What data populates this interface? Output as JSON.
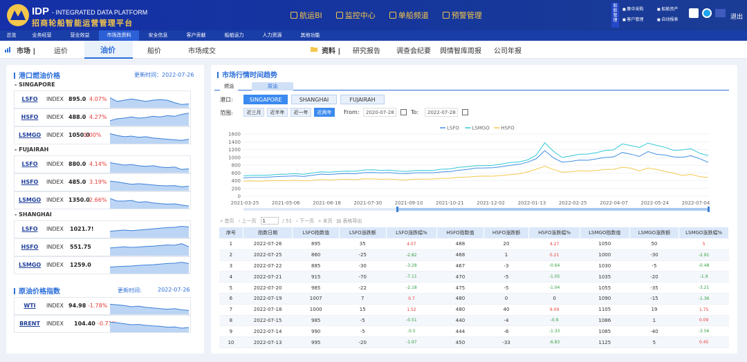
{
  "header": {
    "brand_short": "IDP",
    "brand_sub": "- INTEGRATED DATA PLATFORM",
    "brand_cn": "招商轮船智能运营管理平台",
    "nav": [
      "航运BI",
      "监控中心",
      "单船频道",
      "预警管理"
    ],
    "side_tab": "船舶管理",
    "tools": [
      "集中采购",
      "船舶资产",
      "客户管理",
      "自动报表"
    ],
    "exit": "退出"
  },
  "main_nav": {
    "items": [
      "总览",
      "业务经营",
      "营业效益",
      "市场改资料",
      "安全信息",
      "客户贡献",
      "船舶运力",
      "人力资源",
      "其他功能"
    ],
    "active_index": 3
  },
  "sub_nav": {
    "market_label": "市场 |",
    "market_items": [
      "运价",
      "油价",
      "船价",
      "市场成交"
    ],
    "active": "油价",
    "data_label": "资料 |",
    "data_items": [
      "研究报告",
      "调查会纪要",
      "舆情智库周报",
      "公司年报"
    ]
  },
  "fuel_panel": {
    "title": "港口燃油价格",
    "updated": "更新时间：2022-07-26",
    "groups": [
      {
        "region": "- SINGAPORE",
        "rows": [
          {
            "name": "LSFO",
            "index": "INDEX",
            "value": "895.0",
            "pct": "4.07%"
          },
          {
            "name": "HSFO",
            "index": "INDEX",
            "value": "488.0",
            "pct": "4.27%"
          },
          {
            "name": "LSMGO",
            "index": "INDEX",
            "value": "1050.0",
            "pct": "5.00%"
          }
        ]
      },
      {
        "region": "- FUJAIRAH",
        "rows": [
          {
            "name": "LSFO",
            "index": "INDEX",
            "value": "880.0",
            "pct": "4.14%"
          },
          {
            "name": "HSFO",
            "index": "INDEX",
            "value": "485.0",
            "pct": "3.19%"
          },
          {
            "name": "LSMGO",
            "index": "INDEX",
            "value": "1350.0",
            "pct": "2.66%"
          }
        ]
      },
      {
        "region": "- SHANGHAI",
        "rows": [
          {
            "name": "LSFO",
            "index": "INDEX",
            "value": "1021.7!",
            "pct": ""
          },
          {
            "name": "HSFO",
            "index": "INDEX",
            "value": "551.75",
            "pct": ""
          },
          {
            "name": "LSMGO",
            "index": "INDEX",
            "value": "1259.0",
            "pct": ""
          }
        ]
      }
    ]
  },
  "crude_panel": {
    "title": "原油价格指数",
    "updated_label": "更新时间:",
    "updated_date": "2022-07-26",
    "rows": [
      {
        "name": "WTI",
        "index": "INDEX",
        "value": "94.98",
        "pct": "-1.78%"
      },
      {
        "name": "BRENT",
        "index": "INDEX",
        "value": "104.40",
        "pct": "-0.71%"
      }
    ]
  },
  "trend_panel": {
    "title": "市场行情时间趋势",
    "tabs": [
      "燃油",
      "原油"
    ],
    "port_label": "港口:",
    "ports": [
      "SINGAPORE",
      "SHANGHAI",
      "FUJAIRAH"
    ],
    "active_port": "SINGAPORE",
    "range_label": "范围:",
    "ranges": [
      "近三月",
      "近半年",
      "近一年",
      "近两年"
    ],
    "active_range": "近两年",
    "from_label": "From:",
    "from_value": "2020-07-28",
    "to_label": "To:",
    "to_value": "2022-07-28"
  },
  "chart_data": {
    "type": "line",
    "x_ticks": [
      "2021-03-25",
      "2021-05-06",
      "2021-06-18",
      "2021-07-30",
      "2021-09-10",
      "2021-10-21",
      "2021-12-02",
      "2022-01-13",
      "2022-02-25",
      "2022-04-07",
      "2022-05-24",
      "2022-07-04"
    ],
    "ylim": [
      0,
      1600
    ],
    "y_ticks": [
      0,
      200,
      400,
      600,
      800,
      1000,
      1200,
      1400,
      1600
    ],
    "legend_position": "top-right",
    "grid": true,
    "series": [
      {
        "name": "LSFO",
        "color": "#3f8fe0",
        "values": [
          470,
          478,
          492,
          488,
          505,
          520,
          515,
          512,
          540,
          560,
          565,
          575,
          580,
          585,
          600,
          610,
          605,
          600,
          590,
          585,
          595,
          610,
          600,
          620,
          640,
          660,
          690,
          730,
          720,
          740,
          760,
          790,
          830,
          870,
          960,
          1180,
          980,
          880,
          900,
          920,
          930,
          960,
          990,
          1020,
          1120,
          1080,
          1030,
          1140,
          1080,
          1060,
          1000,
          1010,
          1040,
          960,
          880
        ]
      },
      {
        "name": "LSMGO",
        "color": "#30c8d8",
        "values": [
          520,
          532,
          545,
          540,
          560,
          575,
          570,
          568,
          600,
          620,
          625,
          635,
          640,
          648,
          668,
          680,
          670,
          662,
          650,
          640,
          655,
          672,
          660,
          690,
          710,
          735,
          760,
          790,
          780,
          800,
          830,
          860,
          890,
          930,
          1050,
          1380,
          1150,
          1000,
          1040,
          1070,
          1090,
          1120,
          1170,
          1200,
          1340,
          1300,
          1260,
          1360,
          1310,
          1260,
          1170,
          1200,
          1220,
          1100,
          1050
        ]
      },
      {
        "name": "HSFO",
        "color": "#f2c94c",
        "values": [
          385,
          390,
          395,
          392,
          400,
          405,
          402,
          400,
          410,
          420,
          425,
          428,
          430,
          432,
          440,
          445,
          440,
          435,
          430,
          425,
          432,
          445,
          440,
          455,
          470,
          480,
          495,
          515,
          510,
          520,
          535,
          550,
          580,
          620,
          690,
          780,
          680,
          620,
          630,
          645,
          650,
          660,
          680,
          700,
          740,
          720,
          660,
          720,
          690,
          640,
          580,
          540,
          560,
          500,
          488
        ]
      }
    ]
  },
  "pager": {
    "first": "« 首页",
    "prev": "‹ 上一页",
    "page": "1",
    "total": "/ 51",
    "next": "› 下一页",
    "last": "» 末页",
    "export": "表格导出"
  },
  "table": {
    "headers": [
      "序号",
      "指数日期",
      "LSFO指数值",
      "LSFO涨跌额",
      "LSFO涨跌幅%",
      "HSFO指数值",
      "HSFO涨跌额",
      "HSFO涨跌幅%",
      "LSMGO指数值",
      "LSMGO涨跌额",
      "LSMGO涨跌幅%"
    ],
    "rows": [
      [
        "1",
        "2022-07-26",
        "895",
        "35",
        "4.07",
        "488",
        "20",
        "4.27",
        "1050",
        "50",
        "5"
      ],
      [
        "2",
        "2022-07-25",
        "860",
        "-25",
        "-2.82",
        "468",
        "1",
        "0.21",
        "1000",
        "-30",
        "-2.91"
      ],
      [
        "3",
        "2022-07-22",
        "885",
        "-30",
        "-3.28",
        "467",
        "-3",
        "-0.64",
        "1030",
        "-5",
        "-0.48"
      ],
      [
        "4",
        "2022-07-21",
        "915",
        "-70",
        "-7.11",
        "470",
        "-5",
        "-1.05",
        "1035",
        "-20",
        "-1.9"
      ],
      [
        "5",
        "2022-07-20",
        "985",
        "-22",
        "-2.18",
        "475",
        "-5",
        "-1.04",
        "1055",
        "-35",
        "-3.21"
      ],
      [
        "6",
        "2022-07-19",
        "1007",
        "7",
        "0.7",
        "480",
        "0",
        "0",
        "1090",
        "-15",
        "-1.36"
      ],
      [
        "7",
        "2022-07-18",
        "1000",
        "15",
        "1.52",
        "480",
        "40",
        "9.09",
        "1105",
        "19",
        "1.75"
      ],
      [
        "8",
        "2022-07-15",
        "985",
        "-5",
        "-0.51",
        "440",
        "-4",
        "-0.9",
        "1086",
        "1",
        "0.09"
      ],
      [
        "9",
        "2022-07-14",
        "990",
        "-5",
        "-0.5",
        "444",
        "-6",
        "-1.33",
        "1085",
        "-40",
        "-3.56"
      ],
      [
        "10",
        "2022-07-13",
        "995",
        "-20",
        "-1.97",
        "450",
        "-33",
        "-6.83",
        "1125",
        "5",
        "0.45"
      ]
    ]
  },
  "colors": {
    "accent": "#2b6ed9",
    "header": "#1530a8",
    "gold": "#f4c64b",
    "up": "#e53935",
    "down": "#2e9e3f"
  }
}
